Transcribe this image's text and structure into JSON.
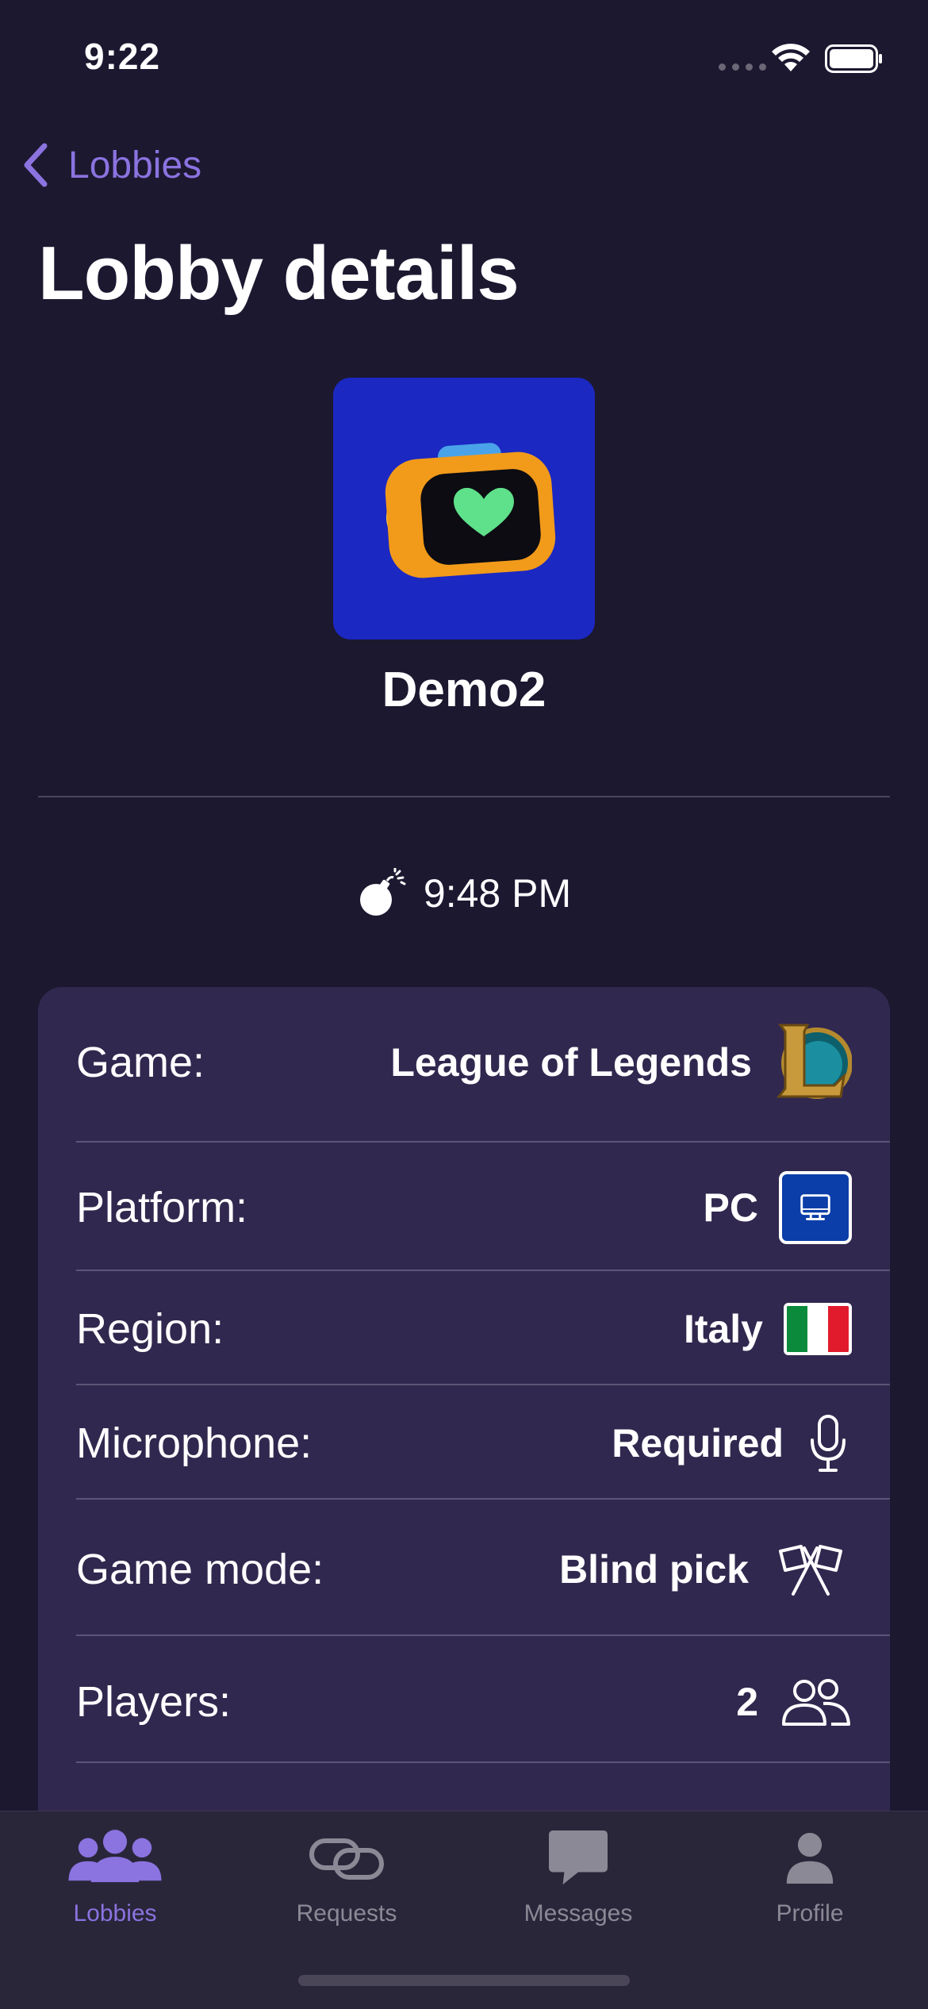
{
  "status_bar": {
    "time": "9:22"
  },
  "nav": {
    "back_label": "Lobbies"
  },
  "page_title": "Lobby details",
  "lobby": {
    "name": "Demo2",
    "expires_at": "9:48 PM"
  },
  "details": {
    "game": {
      "label": "Game:",
      "value": "League of Legends",
      "icon": "league-of-legends-logo"
    },
    "platform": {
      "label": "Platform:",
      "value": "PC",
      "icon": "desktop-icon"
    },
    "region": {
      "label": "Region:",
      "value": "Italy",
      "icon": "italy-flag"
    },
    "microphone": {
      "label": "Microphone:",
      "value": "Required",
      "icon": "microphone-icon"
    },
    "game_mode": {
      "label": "Game mode:",
      "value": "Blind pick",
      "icon": "crossed-flags-icon"
    },
    "players": {
      "label": "Players:",
      "value": "2",
      "icon": "people-icon"
    }
  },
  "tabs": [
    {
      "label": "Lobbies",
      "icon": "people-group-icon",
      "active": true
    },
    {
      "label": "Requests",
      "icon": "link-icon",
      "active": false
    },
    {
      "label": "Messages",
      "icon": "chat-bubble-icon",
      "active": false
    },
    {
      "label": "Profile",
      "icon": "person-icon",
      "active": false
    }
  ],
  "colors": {
    "background": "#1c1830",
    "card": "#31284f",
    "accent": "#8b73e0",
    "tab_bar": "#29263a",
    "avatar_bg": "#1b28c2"
  }
}
